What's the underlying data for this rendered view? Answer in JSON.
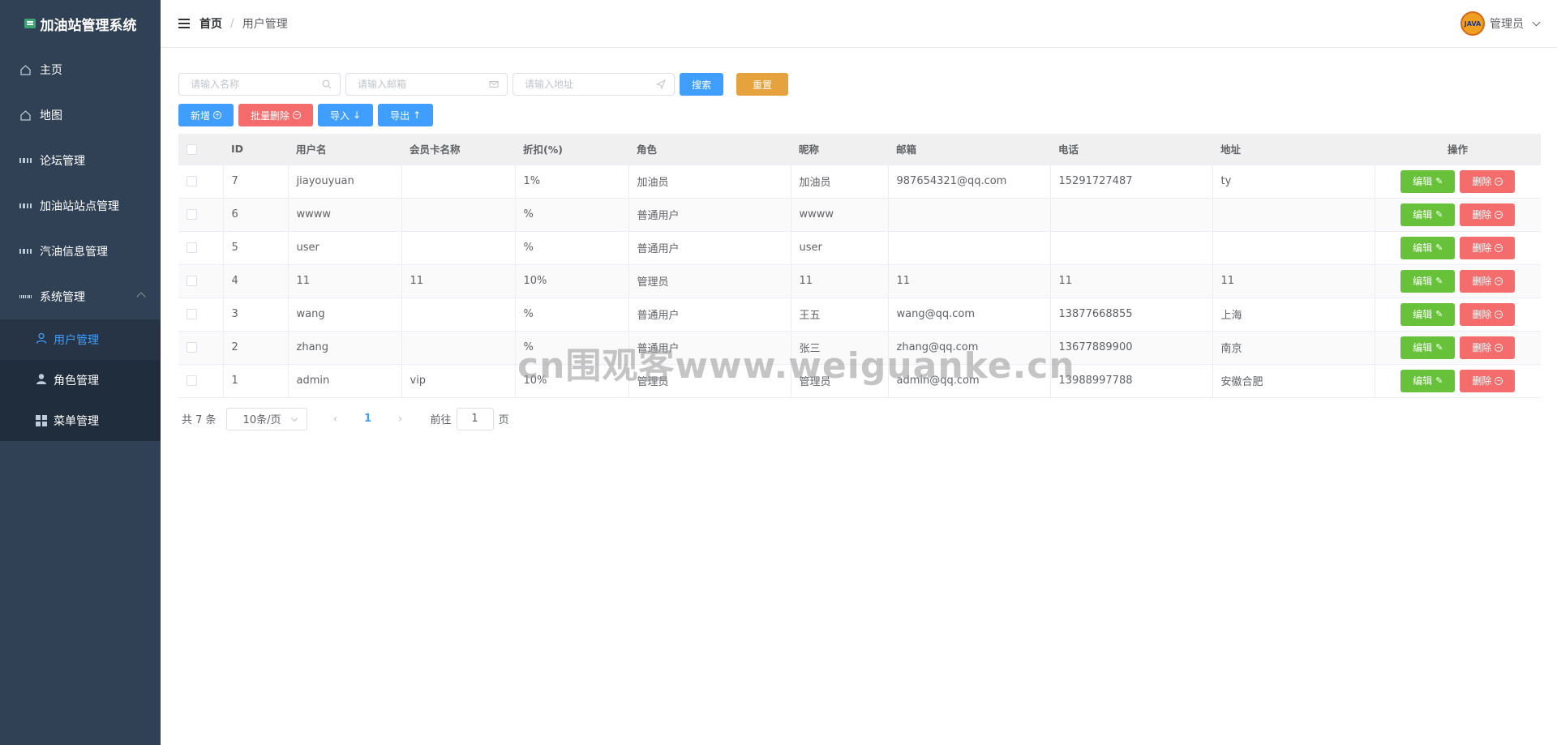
{
  "app": {
    "title": "加油站管理系统"
  },
  "sidebar": {
    "items": [
      {
        "label": "主页",
        "icon": "house-icon"
      },
      {
        "label": "地图",
        "icon": "house-icon"
      },
      {
        "label": "论坛管理",
        "icon": "grid-icon"
      },
      {
        "label": "加油站站点管理",
        "icon": "grid-icon"
      },
      {
        "label": "汽油信息管理",
        "icon": "grid-icon"
      },
      {
        "label": "系统管理",
        "icon": "apps-icon",
        "expanded": true
      }
    ],
    "submenu": [
      {
        "label": "用户管理",
        "icon": "user-outline-icon",
        "active": true
      },
      {
        "label": "角色管理",
        "icon": "user-solid-icon"
      },
      {
        "label": "菜单管理",
        "icon": "grid-icon"
      }
    ]
  },
  "header": {
    "breadcrumb_home": "首页",
    "breadcrumb_sep": "/",
    "breadcrumb_current": "用户管理",
    "avatar_text": "JAVA",
    "username": "管理员"
  },
  "search": {
    "name_placeholder": "请输入名称",
    "email_placeholder": "请输入邮箱",
    "address_placeholder": "请输入地址",
    "search_label": "搜索",
    "reset_label": "重置"
  },
  "actions": {
    "add_label": "新增",
    "batch_delete_label": "批量删除",
    "import_label": "导入",
    "export_label": "导出"
  },
  "table": {
    "columns": [
      "ID",
      "用户名",
      "会员卡名称",
      "折扣(%)",
      "角色",
      "昵称",
      "邮箱",
      "电话",
      "地址",
      "操作"
    ],
    "edit_label": "编辑",
    "delete_label": "删除",
    "rows": [
      {
        "id": "7",
        "username": "jiayouyuan",
        "card": "",
        "discount": "1%",
        "role": "加油员",
        "nickname": "加油员",
        "email": "987654321@qq.com",
        "phone": "15291727487",
        "address": "ty"
      },
      {
        "id": "6",
        "username": "wwww",
        "card": "",
        "discount": "%",
        "role": "普通用户",
        "nickname": "wwww",
        "email": "",
        "phone": "",
        "address": ""
      },
      {
        "id": "5",
        "username": "user",
        "card": "",
        "discount": "%",
        "role": "普通用户",
        "nickname": "user",
        "email": "",
        "phone": "",
        "address": ""
      },
      {
        "id": "4",
        "username": "11",
        "card": "11",
        "discount": "10%",
        "role": "管理员",
        "nickname": "11",
        "email": "11",
        "phone": "11",
        "address": "11"
      },
      {
        "id": "3",
        "username": "wang",
        "card": "",
        "discount": "%",
        "role": "普通用户",
        "nickname": "王五",
        "email": "wang@qq.com",
        "phone": "13877668855",
        "address": "上海"
      },
      {
        "id": "2",
        "username": "zhang",
        "card": "",
        "discount": "%",
        "role": "普通用户",
        "nickname": "张三",
        "email": "zhang@qq.com",
        "phone": "13677889900",
        "address": "南京"
      },
      {
        "id": "1",
        "username": "admin",
        "card": "vip",
        "discount": "10%",
        "role": "管理员",
        "nickname": "管理员",
        "email": "admin@qq.com",
        "phone": "13988997788",
        "address": "安徽合肥"
      }
    ]
  },
  "pagination": {
    "total_text": "共 7 条",
    "page_size": "10条/页",
    "current_page": "1",
    "goto_label": "前往",
    "goto_value": "1",
    "page_suffix": "页"
  },
  "watermark": "cn围观客www.weiguanke.cn",
  "colors": {
    "sidebar_bg": "#304156",
    "primary": "#409eff",
    "success": "#67c23a",
    "danger": "#f56c6c",
    "warning": "#e6a23c"
  }
}
